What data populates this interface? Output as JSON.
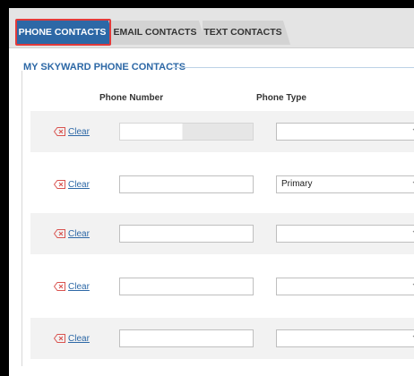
{
  "tabs": [
    {
      "label": "PHONE CONTACTS",
      "active": true
    },
    {
      "label": "EMAIL CONTACTS",
      "active": false
    },
    {
      "label": "TEXT CONTACTS",
      "active": false
    }
  ],
  "section": {
    "title": "MY SKYWARD PHONE CONTACTS"
  },
  "table": {
    "headers": {
      "phone": "Phone Number",
      "type": "Phone Type"
    },
    "clear_label": "Clear",
    "rows": [
      {
        "phone": "",
        "type": ""
      },
      {
        "phone": "",
        "type": "Primary"
      },
      {
        "phone": "",
        "type": ""
      },
      {
        "phone": "",
        "type": ""
      },
      {
        "phone": "",
        "type": ""
      }
    ]
  },
  "colors": {
    "accent": "#2d68a6",
    "highlight": "#e23a3a",
    "clear_icon": "#d9534f"
  },
  "icons": {
    "clear": "clear-x-icon",
    "dropdown": "chevron-down-icon"
  }
}
